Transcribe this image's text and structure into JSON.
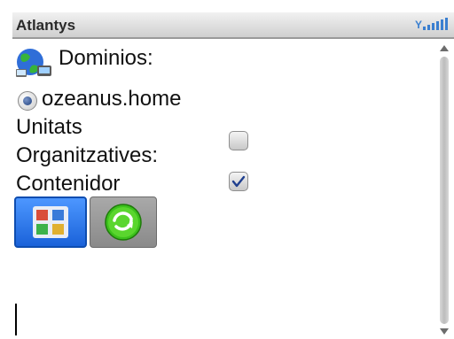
{
  "header": {
    "title": "Atlantys",
    "signal_icon": "signal-strength-icon"
  },
  "form": {
    "domains_label": "Dominios:",
    "domain_option": "ozeanus.home",
    "units_label_line1": "Unitats",
    "units_label_line2": "Organitzatives:",
    "units_checked": false,
    "container_label": "Contenidor",
    "container_checked": true
  },
  "toolbar": {
    "button1_icon": "users-grid-icon",
    "button2_icon": "refresh-arrow-icon"
  },
  "colors": {
    "selected_button": "#2d7ef0",
    "refresh_green": "#3cc11c"
  }
}
